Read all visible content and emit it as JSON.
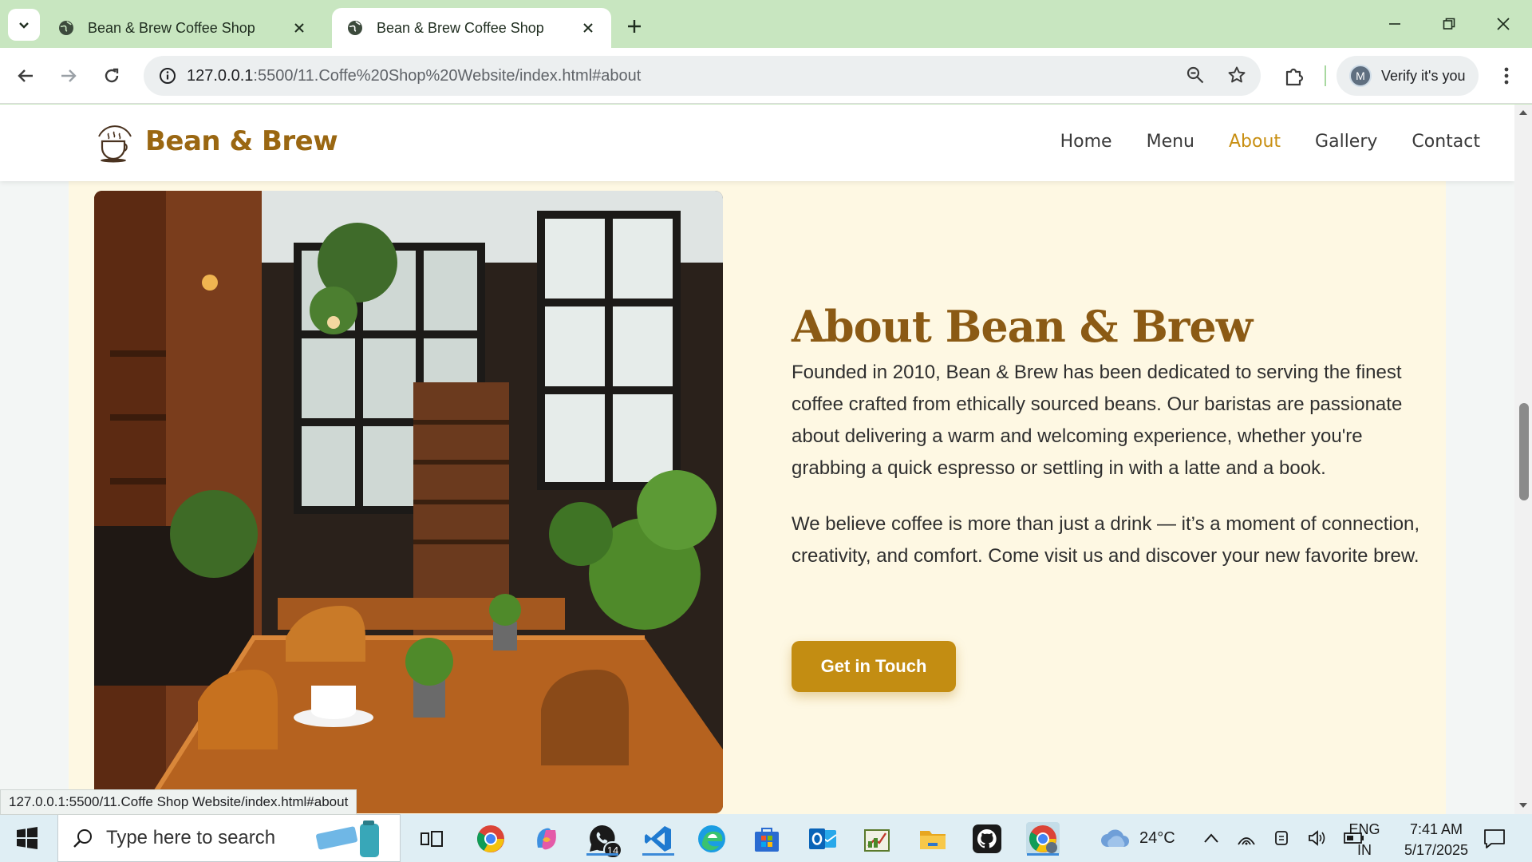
{
  "browser": {
    "tabs": [
      {
        "title": "Bean & Brew Coffee Shop",
        "active": false
      },
      {
        "title": "Bean & Brew Coffee Shop",
        "active": true
      }
    ],
    "address": {
      "host": "127.0.0.1",
      "path": ":5500/11.Coffe%20Shop%20Website/index.html#about"
    },
    "profile": {
      "initial": "M",
      "label": "Verify it's you"
    },
    "status_url": "127.0.0.1:5500/11.Coffe Shop Website/index.html#about"
  },
  "site": {
    "brand": "Bean & Brew",
    "nav": [
      "Home",
      "Menu",
      "About",
      "Gallery",
      "Contact"
    ],
    "current_nav": "About",
    "about": {
      "title": "About Bean & Brew",
      "paragraphs": [
        "Founded in 2010, Bean & Brew has been dedicated to serving the finest coffee crafted from ethically sourced beans. Our baristas are passionate about delivering a warm and welcoming experience, whether you're grabbing a quick espresso or settling in with a latte and a book.",
        "We believe coffee is more than just a drink — it’s a moment of connection, creativity, and comfort. Come visit us and discover your new favorite brew."
      ],
      "cta": "Get in Touch"
    },
    "colors": {
      "brand": "#9a6712",
      "accent": "#c38d12",
      "section_bg": "#fef8e3"
    }
  },
  "taskbar": {
    "search_placeholder": "Type here to search",
    "whatsapp_badge": "14",
    "weather": "24°C",
    "lang_1": "ENG",
    "lang_2": "IN",
    "time": "7:41 AM",
    "date": "5/17/2025"
  }
}
